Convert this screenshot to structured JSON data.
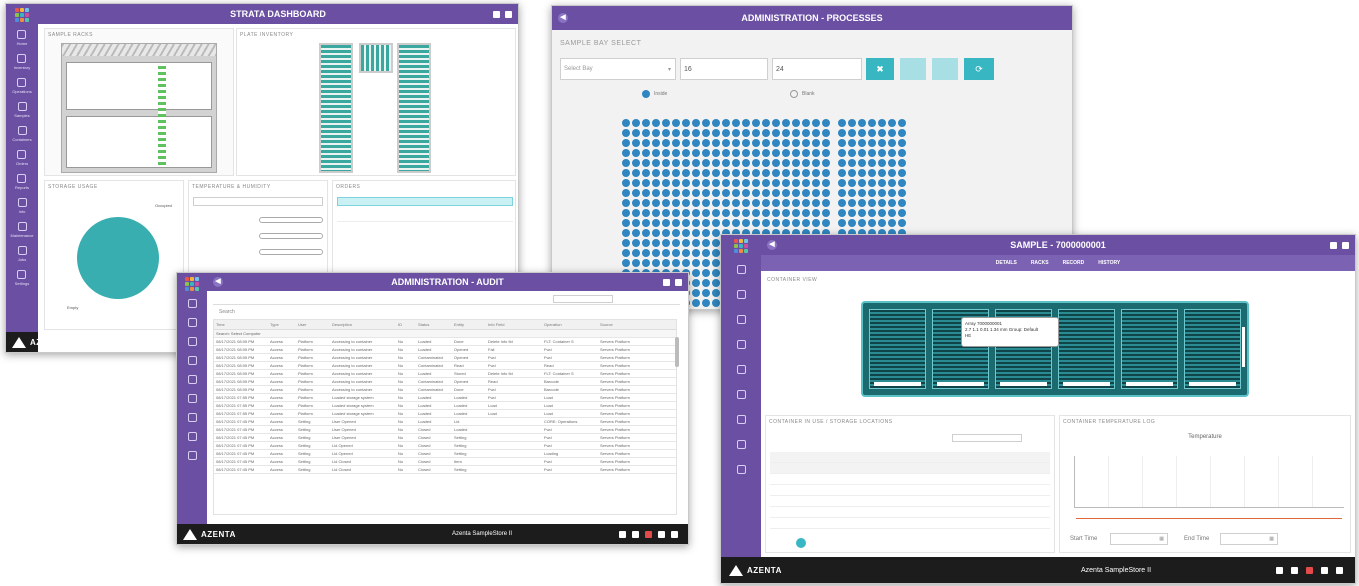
{
  "dashboard": {
    "title": "STRATA DASHBOARD",
    "sections": [
      "SAMPLE RACKS",
      "PLATE INVENTORY",
      "STORAGE USAGE",
      "TEMPERATURE & HUMIDITY",
      "ORDERS"
    ],
    "pie_labels": [
      "Occupied",
      "Empty"
    ],
    "sidebar": [
      "Home",
      "Inventory",
      "Operations",
      "Samples",
      "Containers",
      "Orders",
      "Reports",
      "Info",
      "Maintenance",
      "Jobs",
      "Settings"
    ],
    "brand": "AZENTA"
  },
  "processes": {
    "title": "ADMINISTRATION - PROCESSES",
    "section": "SAMPLE BAY SELECT",
    "select_value": "Select Bay",
    "input1": "16",
    "input2": "24",
    "radio_labels": [
      "Inside",
      "Blank"
    ]
  },
  "audit": {
    "title": "ADMINISTRATION - AUDIT",
    "section_label": "Search",
    "group_label": "Search: Select Computer",
    "columns": [
      "Time",
      "Type",
      "User",
      "Description",
      "ID",
      "Status",
      "Entity",
      "Info Field",
      "Operation",
      "Source"
    ],
    "rows": [
      [
        "08/17/2021 08:05 PM",
        "Access",
        "Platform",
        "Accessing to container",
        "No",
        "Loaded",
        "Done",
        "Delete Info fld",
        "FLT: Container S",
        "Servers Platform"
      ],
      [
        "08/17/2021 08:05 PM",
        "Access",
        "Platform",
        "Accessing to container",
        "No",
        "Loaded",
        "Opened",
        "Fail",
        "Fwd",
        "Servers Platform"
      ],
      [
        "08/17/2021 08:05 PM",
        "Access",
        "Platform",
        "Accessing to container",
        "No",
        "Contaminated",
        "Opened",
        "Fwd",
        "Fwd",
        "Servers Platform"
      ],
      [
        "08/17/2021 08:05 PM",
        "Access",
        "Platform",
        "Accessing to container",
        "No",
        "Contaminated",
        "Read",
        "Fwd",
        "Read",
        "Servers Platform"
      ],
      [
        "08/17/2021 08:05 PM",
        "Access",
        "Platform",
        "Accessing to container",
        "No",
        "Loaded",
        "Stored",
        "Delete Info fld",
        "FLT: Container S",
        "Servers Platform"
      ],
      [
        "08/17/2021 08:05 PM",
        "Access",
        "Platform",
        "Accessing to container",
        "No",
        "Contaminated",
        "Opened",
        "Read",
        "Barcode",
        "Servers Platform"
      ],
      [
        "08/17/2021 08:05 PM",
        "Access",
        "Platform",
        "Accessing to container",
        "No",
        "Contaminated",
        "Done",
        "Fwd",
        "Barcode",
        "Servers Platform"
      ],
      [
        "08/17/2021 07:55 PM",
        "Access",
        "Platform",
        "Loaded storage system",
        "No",
        "Loaded",
        "Loaded",
        "Fwd",
        "Load",
        "Servers Platform"
      ],
      [
        "08/17/2021 07:55 PM",
        "Access",
        "Platform",
        "Loaded storage system",
        "No",
        "Loaded",
        "Loaded",
        "Load",
        "Load",
        "Servers Platform"
      ],
      [
        "08/17/2021 07:55 PM",
        "Access",
        "Platform",
        "Loaded storage system",
        "No",
        "Loaded",
        "Loaded",
        "Load",
        "Load",
        "Servers Platform"
      ],
      [
        "08/17/2021 07:45 PM",
        "Access",
        "Setting",
        "User Opened",
        "No",
        "Loaded",
        "Lid",
        "",
        "CORE: Operations",
        "Servers Platform"
      ],
      [
        "08/17/2021 07:45 PM",
        "Access",
        "Setting",
        "User Opened",
        "No",
        "Closed",
        "Loaded",
        "",
        "Fwd",
        "Servers Platform"
      ],
      [
        "08/17/2021 07:45 PM",
        "Access",
        "Setting",
        "User Opened",
        "No",
        "Closed",
        "Setting",
        "",
        "Fwd",
        "Servers Platform"
      ],
      [
        "08/17/2021 07:45 PM",
        "Access",
        "Setting",
        "Lid Opened",
        "No",
        "Closed",
        "Setting",
        "",
        "Fwd",
        "Servers Platform"
      ],
      [
        "08/17/2021 07:45 PM",
        "Access",
        "Setting",
        "Lid Opened",
        "No",
        "Closed",
        "Setting",
        "",
        "Loading",
        "Servers Platform"
      ],
      [
        "08/17/2021 07:45 PM",
        "Access",
        "Setting",
        "Lid Closed",
        "No",
        "Closed",
        "Item",
        "",
        "Fwd",
        "Servers Platform"
      ],
      [
        "08/17/2021 07:45 PM",
        "Access",
        "Setting",
        "Lid Closed",
        "No",
        "Closed",
        "Setting",
        "",
        "Fwd",
        "Servers Platform"
      ]
    ],
    "footer_text": "Azenta SampleStore II",
    "brand": "AZENTA"
  },
  "sample": {
    "title": "SAMPLE - 7000000001",
    "tabs": [
      "DETAILS",
      "RACKS",
      "RECORD",
      "HISTORY"
    ],
    "section": "CONTAINER VIEW",
    "tooltip_line1": "Array 7000000001",
    "tooltip_line2": "2.7 1.1 0.01 1.34 mm Group: Default",
    "tooltip_line3": "HE",
    "grid_section": "CONTAINER IN USE / STORAGE LOCATIONS",
    "chart_section": "CONTAINER TEMPERATURE LOG",
    "chart_title": "Temperature",
    "start_label": "Start Time",
    "end_label": "End Time",
    "footer_text": "Azenta SampleStore II",
    "brand": "AZENTA"
  },
  "colors": {
    "purple": "#6a4fa3",
    "teal": "#38b7c3",
    "dot_blue": "#2f86c0",
    "dark_teal": "#15565b"
  }
}
